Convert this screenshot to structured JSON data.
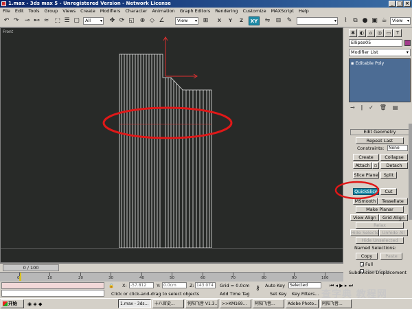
{
  "window": {
    "title": "1.max - 3ds max 5 - Unregistered Version - Network License",
    "minimize": "_",
    "maximize": "□",
    "close": "×"
  },
  "menu": [
    "File",
    "Edit",
    "Tools",
    "Group",
    "Views",
    "Create",
    "Modifiers",
    "Character",
    "Animation",
    "Graph Editors",
    "Rendering",
    "Customize",
    "MAXScript",
    "Help"
  ],
  "toolbar": {
    "selection_filter": "All",
    "ref_coord": "View",
    "ref_coord2": "View",
    "axes": [
      "X",
      "Y",
      "Z",
      "XY"
    ]
  },
  "viewport": {
    "label": "Front"
  },
  "command_panel": {
    "object_name": "Ellipse05",
    "object_color": "#a23b8c",
    "modifier_list": "Modifier List",
    "stack_item": "Editable Poly",
    "rollout": "Edit Geometry",
    "repeat_last": "Repeat Last",
    "constraints_label": "Constraints:",
    "constraints_value": "None",
    "create": "Create",
    "collapse": "Collapse",
    "attach": "Attach",
    "detach": "Detach",
    "slice_plane": "Slice Plane",
    "split": "Split",
    "quickslice": "QuickSlice",
    "cut": "Cut",
    "msmooth": "MSmooth",
    "tessellate": "Tessellate",
    "make_planar": "Make Planar",
    "view_align": "View Align",
    "grid_align": "Grid Align",
    "relax": "Relax",
    "hide_selected": "Hide Selected",
    "unhide_all": "Unhide All",
    "hide_unselected": "Hide Unselected",
    "named_selections": "Named Selections:",
    "copy": "Copy",
    "paste": "Paste",
    "full": "Full",
    "show_cage": "Show Cage",
    "subdivision": "Subdivision Displacement"
  },
  "timeline": {
    "slider": "0 / 100",
    "ticks": [
      "0",
      "10",
      "20",
      "30",
      "40",
      "50",
      "60",
      "70",
      "80",
      "90",
      "100"
    ]
  },
  "status": {
    "x_label": "X:",
    "x_value": "-57.812",
    "y_label": "Y:",
    "y_value": "0.0cm",
    "z_label": "Z:",
    "z_value": "143.074",
    "grid": "Grid = 0.0cm",
    "prompt": "Click or click-and-drag to select objects",
    "add_time_tag": "Add Time Tag",
    "auto_key": "Auto Key",
    "selected": "Selected",
    "set_key": "Set Key",
    "key_filters": "Key Filters..."
  },
  "taskbar": {
    "start": "开始",
    "tasks": [
      "1.max - 3ds...",
      "十八官史...",
      "何阳飞昔 V1.3...",
      ">>KM169...",
      "阿阳飞昔...",
      "Adobe Photo...",
      "阿阳飞昔..."
    ]
  },
  "watermark": "查字典 教程网"
}
